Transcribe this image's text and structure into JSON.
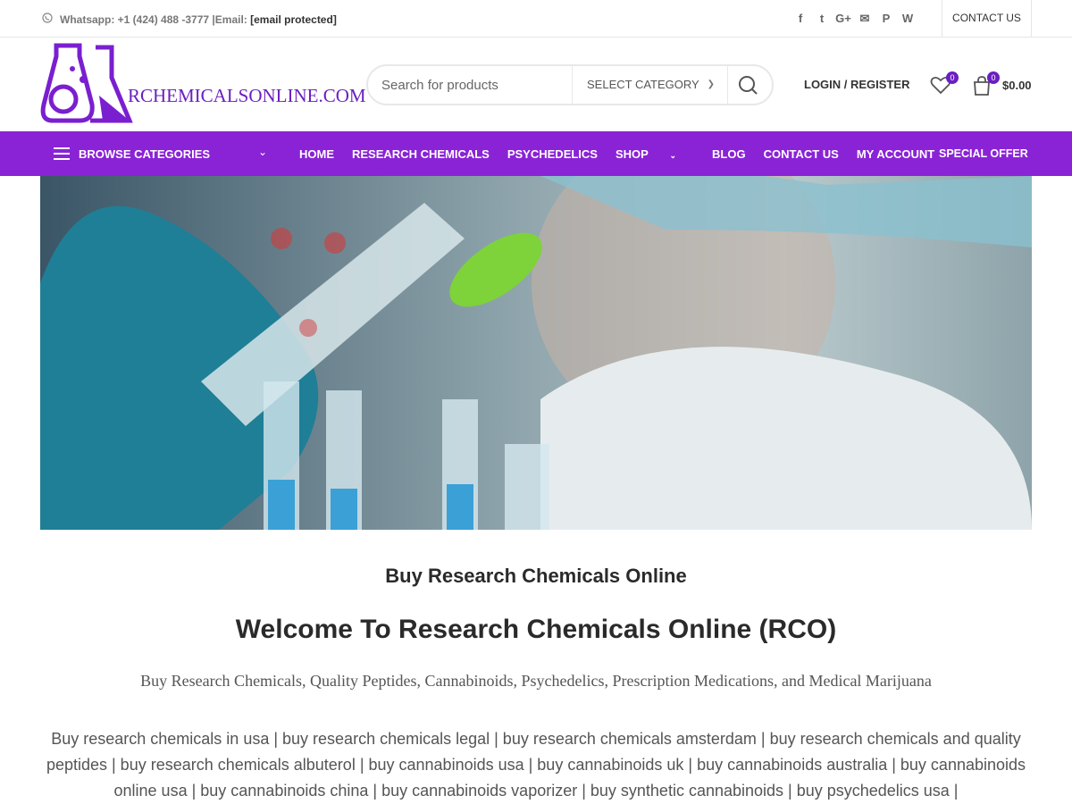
{
  "topbar": {
    "whatsapp_icon": "whatsapp-icon",
    "whatsapp_text": "Whatsapp: +1 (424) 488 -3777 |Email: ",
    "email": "[email protected]",
    "socials": [
      "f",
      "t",
      "G+",
      "✉",
      "P",
      "W"
    ],
    "contact_label": "CONTACT US"
  },
  "header": {
    "logo_text": "RCHEMICALSONLINE.COM",
    "search_placeholder": "Search for products",
    "category_select": "SELECT CATEGORY",
    "login_label": "LOGIN / REGISTER",
    "wishlist_count": "0",
    "cart_count": "0",
    "cart_total": "$0.00"
  },
  "nav": {
    "browse_label": "BROWSE CATEGORIES",
    "items": [
      "HOME",
      "RESEARCH CHEMICALS",
      "PSYCHEDELICS",
      "SHOP",
      "BLOG",
      "CONTACT US",
      "MY ACCOUNT"
    ],
    "special_label": "SPECIAL OFFER"
  },
  "main": {
    "subheading": "Buy Research Chemicals Online",
    "heading": "Welcome To Research Chemicals Online (RCO)",
    "tagline": "Buy Research Chemicals, Quality Peptides, Cannabinoids, Psychedelics, Prescription Medications, and Medical Marijuana",
    "keywords": "Buy research chemicals in usa | buy research chemicals legal | buy research chemicals amsterdam | buy research chemicals and quality peptides | buy research chemicals albuterol | buy cannabinoids usa | buy cannabinoids uk | buy cannabinoids australia | buy cannabinoids online usa | buy cannabinoids china | buy cannabinoids vaporizer | buy synthetic cannabinoids | buy psychedelics usa |"
  },
  "colors": {
    "brand": "#8a23d6",
    "text": "#2a2a2a"
  }
}
